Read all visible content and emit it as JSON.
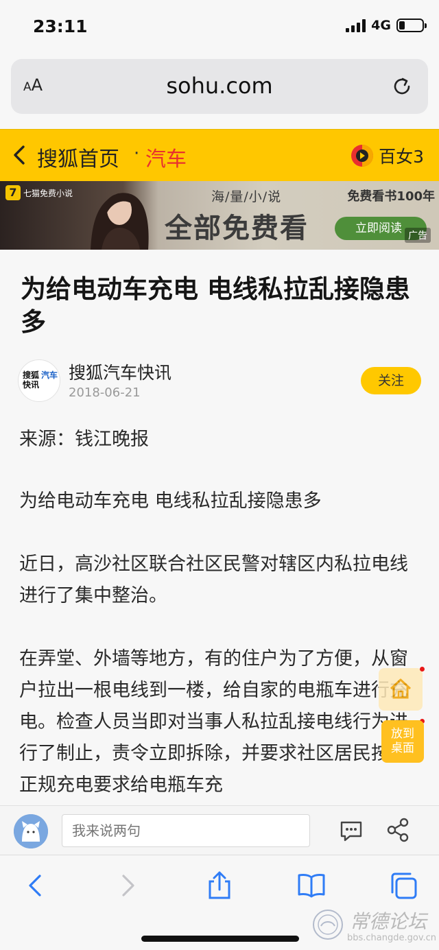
{
  "status_bar": {
    "time": "23:11",
    "network": "4G",
    "battery_level": 0.25
  },
  "browser": {
    "text_size_label": "AA",
    "url": "sohu.com"
  },
  "nav": {
    "home_label": "搜狐首页",
    "separator": "·",
    "channel_label": "汽车",
    "right_label": "百女3"
  },
  "ad": {
    "brand": "七猫免费小说",
    "slogan_top": "海/量/小/说",
    "slogan_main": "全部免费看",
    "promo": "免费看书100年",
    "cta": "立即阅读",
    "tag": "广告"
  },
  "article": {
    "title": "为给电动车充电 电线私拉乱接隐患多",
    "author": {
      "name": "搜狐汽车快讯",
      "date": "2018-06-21",
      "avatar_text_1": "搜狐",
      "avatar_text_2": "快讯",
      "avatar_accent": "汽车"
    },
    "follow_label": "关注",
    "paragraphs": [
      "来源：钱江晚报",
      "为给电动车充电 电线私拉乱接隐患多",
      "近日，高沙社区联合社区民警对辖区内私拉电线进行了集中整治。",
      "在弄堂、外墙等地方，有的住户为了方便，从窗户拉出一根电线到一楼，给自家的电瓶车进行充电。检查人员当即对当事人私拉乱接电线行为进行了制止，责令立即拆除，并要求社区居民按照正规充电要求给电瓶车充"
    ]
  },
  "floating": {
    "desktop_label_1": "放到",
    "desktop_label_2": "桌面"
  },
  "comment_bar": {
    "placeholder": "我来说两句"
  },
  "watermark": {
    "title": "常德论坛",
    "url": "bbs.changde.gov.cn"
  },
  "colors": {
    "brand_yellow": "#ffc700",
    "channel_red": "#e8302f",
    "ios_blue": "#2f7cf6"
  },
  "icons": [
    "reload-icon",
    "back-chevron-icon",
    "sohu-video-icon",
    "comment-icon",
    "share-icon",
    "home-icon",
    "toolbar-back-icon",
    "toolbar-forward-icon",
    "toolbar-share-icon",
    "bookmarks-icon",
    "tabs-icon"
  ]
}
